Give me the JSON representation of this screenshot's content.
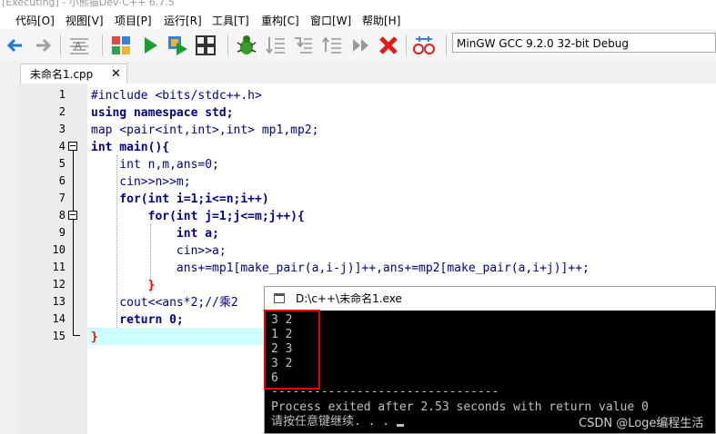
{
  "window_title": "[Executing] - 小熊猫Dev-C++ 6.7.5",
  "menu": [
    "代码[O]",
    "视图[V]",
    "项目[P]",
    "运行[R]",
    "工具[T]",
    "重构[C]",
    "窗口[W]",
    "帮助[H]"
  ],
  "toolbar": {
    "icons": [
      "back-arrow-icon",
      "forward-arrow-icon",
      "format-icon",
      "compile-icon",
      "run-icon",
      "compile-run-icon",
      "rebuild-icon",
      "debug-icon",
      "step-over-icon",
      "step-into-icon",
      "step-out-icon",
      "continue-icon",
      "stop-icon",
      "watch-icon"
    ],
    "compiler": "MinGW GCC 9.2.0 32-bit Debug"
  },
  "tab": {
    "label": "未命名1.cpp",
    "close": "✕"
  },
  "editor": {
    "line_numbers": [
      "1",
      "2",
      "3",
      "4",
      "5",
      "6",
      "7",
      "8",
      "9",
      "10",
      "11",
      "12",
      "13",
      "14",
      "15"
    ],
    "lines": [
      "#include <bits/stdc++.h>",
      "using namespace std;",
      "map <pair<int,int>,int> mp1,mp2;",
      "int main(){",
      "    int n,m,ans=0;",
      "    cin>>n>>m;",
      "    for(int i=1;i<=n;i++)",
      "        for(int j=1;j<=m;j++){",
      "            int a;",
      "            cin>>a;",
      "            ans+=mp1[make_pair(a,i-j)]++,ans+=mp2[make_pair(a,i+j)]++;",
      "        }",
      "    cout<<ans*2;//乘2 ",
      "    return 0;",
      "}"
    ]
  },
  "console": {
    "title": "D:\\c++\\未命名1.exe",
    "output": [
      "3 2",
      "1 2",
      "2 3",
      "3 2",
      "6"
    ],
    "separator": "--------------------------------",
    "process_line": "Process exited after 2.53 seconds with return value 0",
    "prompt": "请按任意键继续. . . "
  },
  "watermark": "CSDN @Loge编程生活"
}
